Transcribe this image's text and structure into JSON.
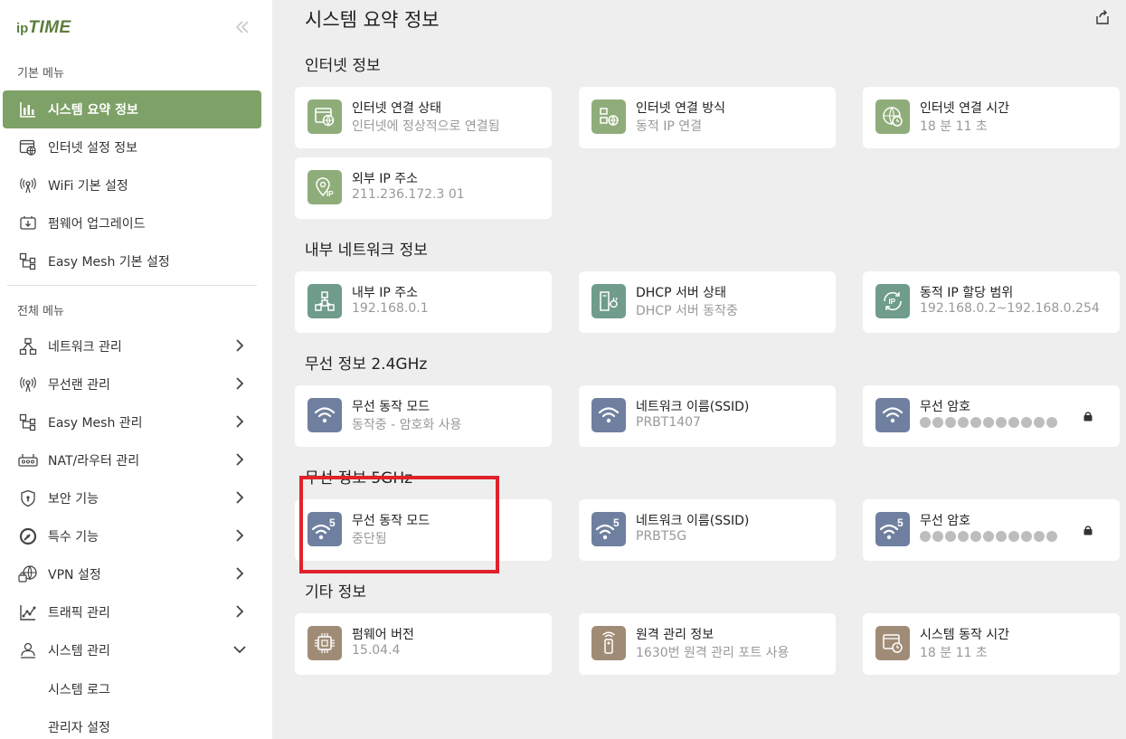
{
  "sidebar": {
    "logo_ip": "ip",
    "logo_time": "TIME",
    "basic_menu_label": "기본 메뉴",
    "basic_items": [
      {
        "label": "시스템 요약 정보",
        "icon": "bar-chart-icon",
        "active": true
      },
      {
        "label": "인터넷 설정 정보",
        "icon": "globe-window-icon"
      },
      {
        "label": "WiFi 기본 설정",
        "icon": "wifi-antenna-icon"
      },
      {
        "label": "펌웨어 업그레이드",
        "icon": "firmware-icon"
      },
      {
        "label": "Easy Mesh 기본 설정",
        "icon": "mesh-icon"
      }
    ],
    "full_menu_label": "전체 메뉴",
    "full_items": [
      {
        "label": "네트워크 관리",
        "icon": "network-icon"
      },
      {
        "label": "무선랜 관리",
        "icon": "wifi-antenna-icon"
      },
      {
        "label": "Easy Mesh 관리",
        "icon": "mesh-icon"
      },
      {
        "label": "NAT/라우터 관리",
        "icon": "router-icon"
      },
      {
        "label": "보안 기능",
        "icon": "shield-icon"
      },
      {
        "label": "특수 기능",
        "icon": "gauge-icon"
      },
      {
        "label": "VPN 설정",
        "icon": "vpn-globe-icon"
      },
      {
        "label": "트래픽 관리",
        "icon": "traffic-chart-icon"
      },
      {
        "label": "시스템 관리",
        "icon": "admin-icon",
        "expanded": true
      }
    ],
    "sub_items": [
      "시스템 로그",
      "관리자 설정"
    ]
  },
  "main": {
    "title": "시스템 요약 정보",
    "sections": {
      "internet": {
        "title": "인터넷 정보",
        "cards": [
          {
            "title": "인터넷 연결 상태",
            "value": "인터넷에 정상적으로 연결됨",
            "icon": "internet-status-icon"
          },
          {
            "title": "인터넷 연결 방식",
            "value": "동적 IP 연결",
            "icon": "connection-type-icon"
          },
          {
            "title": "인터넷 연결 시간",
            "value": "18 분 11 초",
            "icon": "globe-clock-icon"
          },
          {
            "title": "외부 IP 주소",
            "value": "211.236.172.3 01",
            "icon": "ip-pin-icon"
          }
        ]
      },
      "internal": {
        "title": "내부 네트워크 정보",
        "cards": [
          {
            "title": "내부 IP 주소",
            "value": "192.168.0.1",
            "icon": "network-nodes-icon"
          },
          {
            "title": "DHCP 서버 상태",
            "value": "DHCP 서버 동작중",
            "icon": "dhcp-server-icon"
          },
          {
            "title": "동적 IP 할당 범위",
            "value": "192.168.0.2~192.168.0.254",
            "icon": "ip-refresh-icon"
          }
        ]
      },
      "wifi24": {
        "title": "무선 정보 2.4GHz",
        "cards": [
          {
            "title": "무선 동작 모드",
            "value": "동작중 - 암호화 사용",
            "icon": "wifi-icon"
          },
          {
            "title": "네트워크 이름(SSID)",
            "value": "PRBT1407",
            "icon": "wifi-icon"
          },
          {
            "title": "무선 암호",
            "value": "",
            "icon": "wifi-icon"
          }
        ]
      },
      "wifi5": {
        "title": "무선 정보 5GHz",
        "badge": "5",
        "cards": [
          {
            "title": "무선 동작 모드",
            "value": "중단됨",
            "icon": "wifi-5g-icon"
          },
          {
            "title": "네트워크 이름(SSID)",
            "value": "PRBT5G",
            "icon": "wifi-5g-icon"
          },
          {
            "title": "무선 암호",
            "value": "",
            "icon": "wifi-5g-icon"
          }
        ]
      },
      "other": {
        "title": "기타 정보",
        "cards": [
          {
            "title": "펌웨어 버전",
            "value": "15.04.4",
            "icon": "chip-icon"
          },
          {
            "title": "원격 관리 정보",
            "value": "1630번 원격 관리 포트 사용",
            "icon": "remote-icon"
          },
          {
            "title": "시스템 동작 시간",
            "value": "18 분 11 초",
            "icon": "system-clock-icon"
          }
        ]
      }
    }
  },
  "colors": {
    "active_menu": "#7ea167",
    "internet_icon": "#8fad7a",
    "internal_icon": "#6f9c8b",
    "wifi_icon": "#6f7f9f",
    "other_icon": "#a08c76",
    "highlight": "#e1222a"
  }
}
